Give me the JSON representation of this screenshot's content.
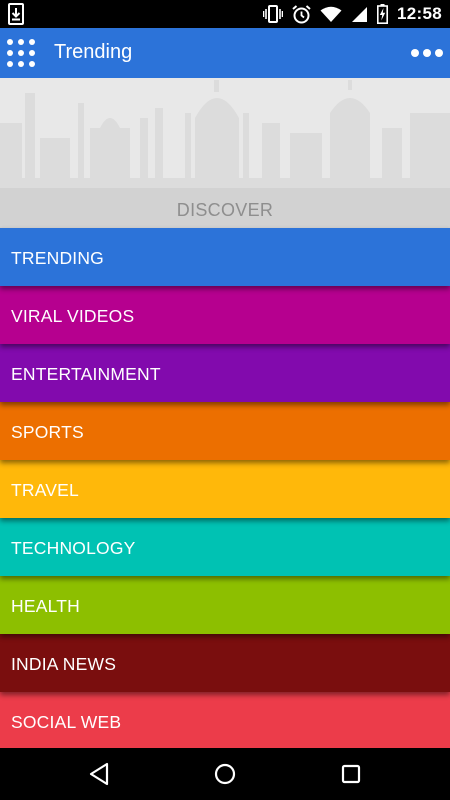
{
  "status_bar": {
    "time": "12:58",
    "icons": [
      "download-icon",
      "vibrate-icon",
      "alarm-icon",
      "wifi-icon",
      "signal-icon",
      "battery-charging-icon"
    ]
  },
  "app_bar": {
    "title": "Trending",
    "menu_icon": "grid-menu-icon",
    "more_icon": "more-options-icon",
    "color": "#2c73d9"
  },
  "hero": {
    "label": "DISCOVER"
  },
  "categories": [
    {
      "label": "TRENDING",
      "color": "#2c73d9"
    },
    {
      "label": "VIRAL VIDEOS",
      "color": "#b6008f"
    },
    {
      "label": "ENTERTAINMENT",
      "color": "#820aad"
    },
    {
      "label": "SPORTS",
      "color": "#ec6f00"
    },
    {
      "label": "TRAVEL",
      "color": "#ffb80a"
    },
    {
      "label": "TECHNOLOGY",
      "color": "#00c2b3"
    },
    {
      "label": "HEALTH",
      "color": "#8dbf00"
    },
    {
      "label": "INDIA NEWS",
      "color": "#7a0e0e"
    },
    {
      "label": "SOCIAL WEB",
      "color": "#ec3c4a"
    }
  ],
  "nav_bar": {
    "icons": [
      "back-icon",
      "home-icon",
      "recents-icon"
    ]
  }
}
